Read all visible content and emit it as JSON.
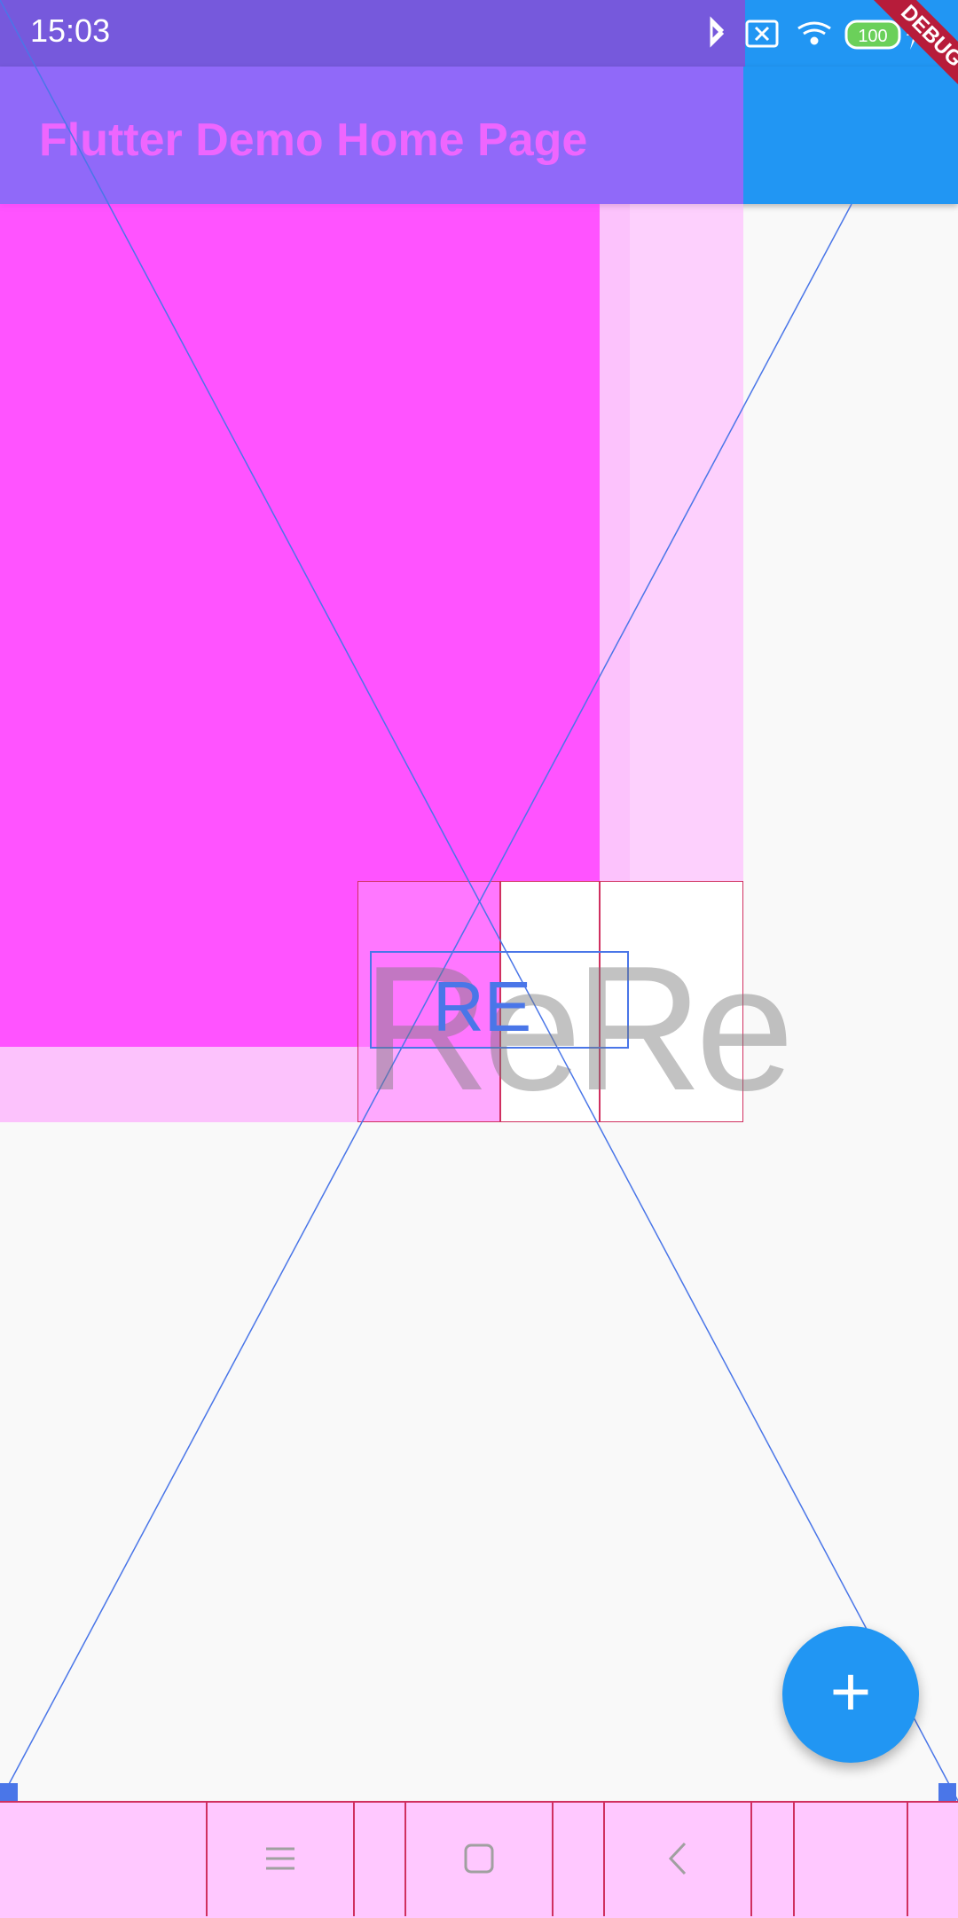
{
  "status_bar": {
    "time": "15:03",
    "battery": "100"
  },
  "app_bar": {
    "title": "Flutter Demo Home Page"
  },
  "debug_banner": {
    "label": "DEBUG"
  },
  "body": {
    "large_text": "ReRe",
    "small_text": "RE"
  },
  "fab": {
    "icon": "add-icon",
    "label": "+"
  },
  "nav_bar": {
    "menu_icon": "menu-icon",
    "home_icon": "home-icon",
    "back_icon": "back-icon"
  },
  "colors": {
    "primary": "#2196f3",
    "debug_magenta": "#ff40ff",
    "debug_outline": "#d03060",
    "debug_blue": "#4a76e8"
  }
}
